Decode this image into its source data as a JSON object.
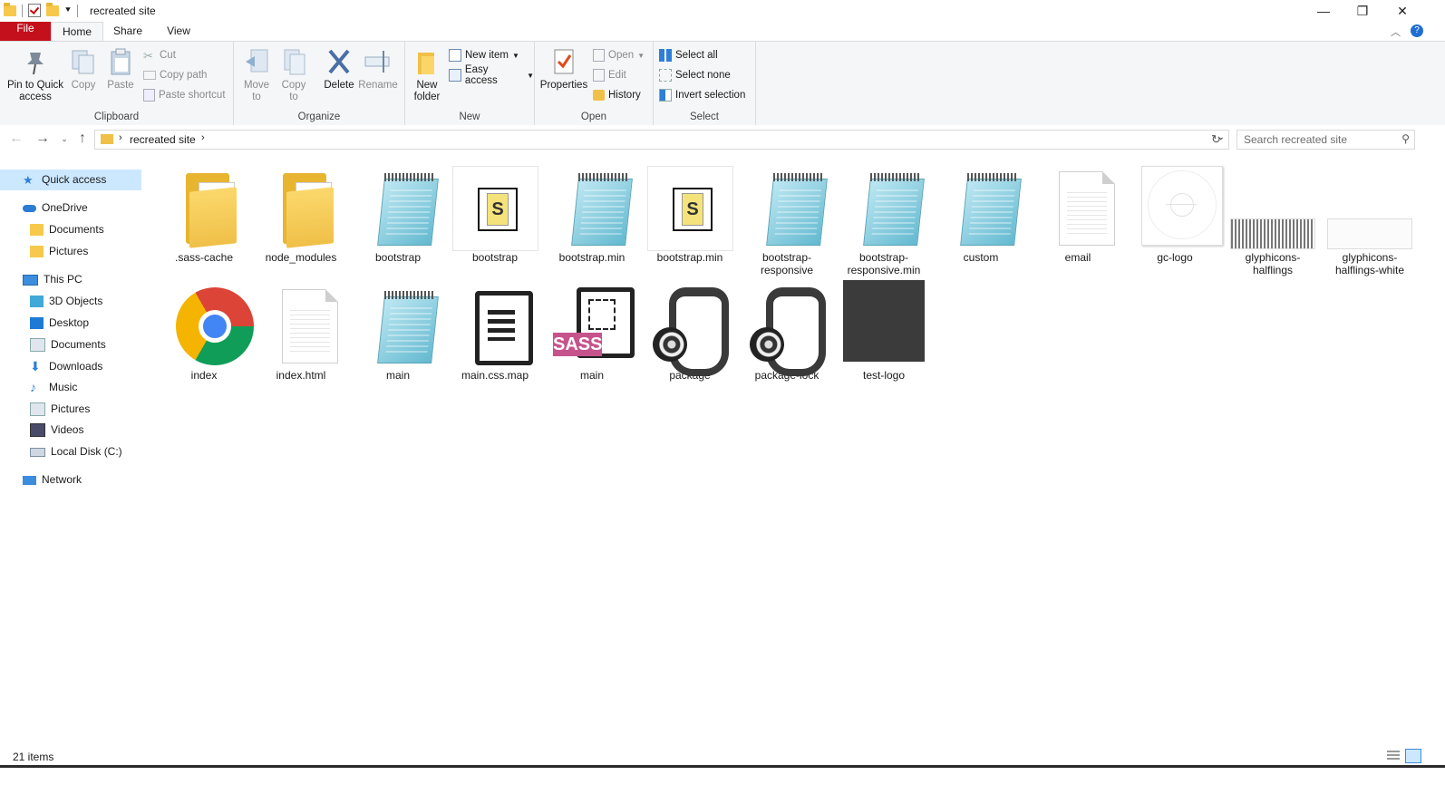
{
  "window": {
    "title": "recreated site",
    "controls": {
      "minimize": "—",
      "maximize": "❐",
      "close": "✕"
    }
  },
  "ribbon_tabs": [
    "File",
    "Home",
    "Share",
    "View"
  ],
  "ribbon": {
    "clipboard": {
      "label": "Clipboard",
      "pin": "Pin to Quick access",
      "copy": "Copy",
      "paste": "Paste",
      "cut": "Cut",
      "copy_path": "Copy path",
      "paste_shortcut": "Paste shortcut"
    },
    "organize": {
      "label": "Organize",
      "move_to": "Move to",
      "copy_to": "Copy to",
      "delete": "Delete",
      "rename": "Rename"
    },
    "new": {
      "label": "New",
      "new_folder": "New folder",
      "new_item": "New item",
      "easy_access": "Easy access"
    },
    "open": {
      "label": "Open",
      "properties": "Properties",
      "open": "Open",
      "edit": "Edit",
      "history": "History"
    },
    "select": {
      "label": "Select",
      "select_all": "Select all",
      "select_none": "Select none",
      "invert": "Invert selection"
    }
  },
  "address": {
    "path": "recreated site",
    "search_placeholder": "Search recreated site"
  },
  "nav": {
    "quick_access": "Quick access",
    "onedrive": "OneDrive",
    "onedrive_items": [
      "Documents",
      "Pictures"
    ],
    "this_pc": "This PC",
    "pc_items": [
      "3D Objects",
      "Desktop",
      "Documents",
      "Downloads",
      "Music",
      "Pictures",
      "Videos",
      "Local Disk (C:)"
    ],
    "network": "Network"
  },
  "files": [
    {
      "name": ".sass-cache",
      "icon": "folder-icon"
    },
    {
      "name": "node_modules",
      "icon": "folder-icon"
    },
    {
      "name": "bootstrap",
      "icon": "notepad-icon"
    },
    {
      "name": "bootstrap",
      "icon": "script-icon"
    },
    {
      "name": "bootstrap.min",
      "icon": "notepad-icon"
    },
    {
      "name": "bootstrap.min",
      "icon": "script-icon"
    },
    {
      "name": "bootstrap-responsive",
      "icon": "notepad-icon"
    },
    {
      "name": "bootstrap-responsive.min",
      "icon": "notepad-icon"
    },
    {
      "name": "custom",
      "icon": "notepad-icon"
    },
    {
      "name": "email",
      "icon": "blank-document-icon"
    },
    {
      "name": "gc-logo",
      "icon": "image-thumbnail-icon"
    },
    {
      "name": "glyphicons-halflings",
      "icon": "image-thumbnail-icon"
    },
    {
      "name": "glyphicons-halflings-white",
      "icon": "image-thumbnail-icon"
    },
    {
      "name": "index",
      "icon": "chrome-icon"
    },
    {
      "name": "index.html",
      "icon": "blank-document-icon"
    },
    {
      "name": "main",
      "icon": "notepad-icon"
    },
    {
      "name": "main.css.map",
      "icon": "document-lines-icon"
    },
    {
      "name": "main",
      "icon": "sass-file-icon"
    },
    {
      "name": "package",
      "icon": "json-icon"
    },
    {
      "name": "package-lock",
      "icon": "json-icon"
    },
    {
      "name": "test-logo",
      "icon": "image-thumbnail-icon"
    }
  ],
  "sass_badge": "SASS",
  "status": {
    "item_count": "21 items"
  }
}
